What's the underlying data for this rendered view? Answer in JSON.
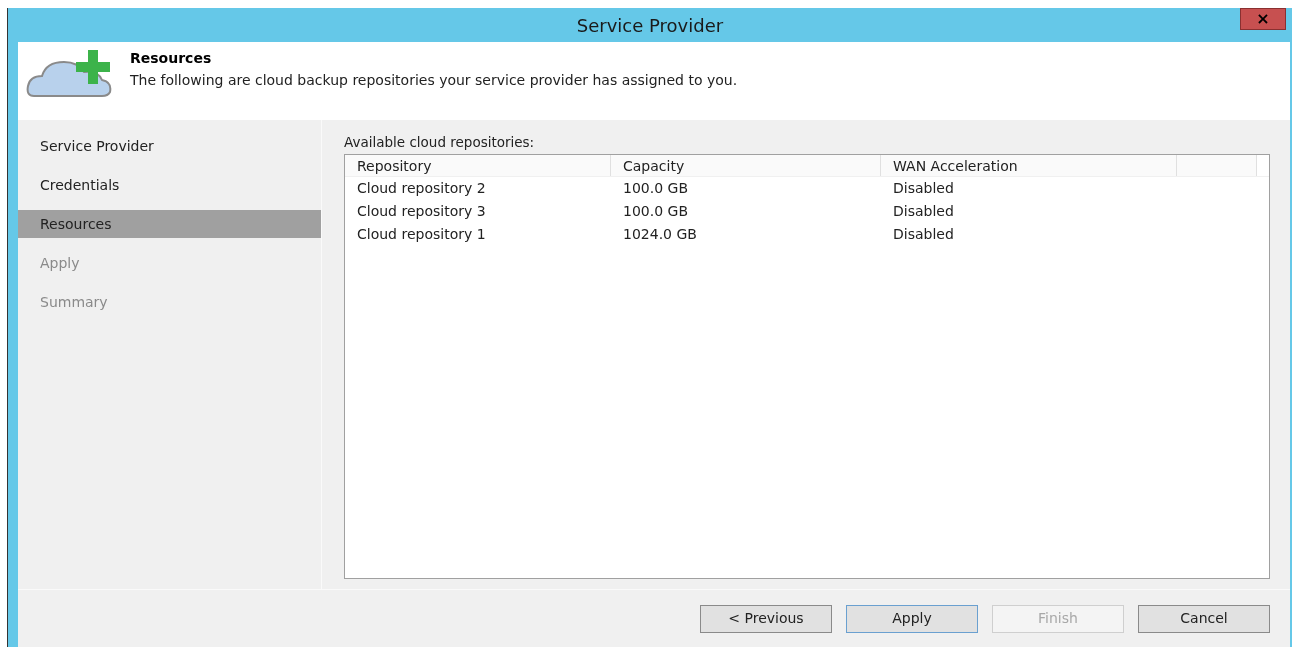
{
  "window": {
    "title": "Service Provider",
    "close": "×"
  },
  "header": {
    "title": "Resources",
    "description": "The following are cloud backup repositories your service provider has assigned to you."
  },
  "steps": [
    {
      "label": "Service Provider",
      "selected": false,
      "disabled": false
    },
    {
      "label": "Credentials",
      "selected": false,
      "disabled": false
    },
    {
      "label": "Resources",
      "selected": true,
      "disabled": false
    },
    {
      "label": "Apply",
      "selected": false,
      "disabled": true
    },
    {
      "label": "Summary",
      "selected": false,
      "disabled": true
    }
  ],
  "table": {
    "label": "Available cloud repositories:",
    "columns": [
      "Repository",
      "Capacity",
      "WAN Acceleration"
    ],
    "rows": [
      [
        "Cloud repository 2",
        "100.0 GB",
        "Disabled"
      ],
      [
        "Cloud repository 3",
        "100.0 GB",
        "Disabled"
      ],
      [
        "Cloud repository 1",
        "1024.0 GB",
        "Disabled"
      ]
    ]
  },
  "buttons": [
    {
      "label": "< Previous",
      "default": false,
      "disabled": false
    },
    {
      "label": "Apply",
      "default": true,
      "disabled": false
    },
    {
      "label": "Finish",
      "default": false,
      "disabled": true
    },
    {
      "label": "Cancel",
      "default": false,
      "disabled": false
    }
  ]
}
